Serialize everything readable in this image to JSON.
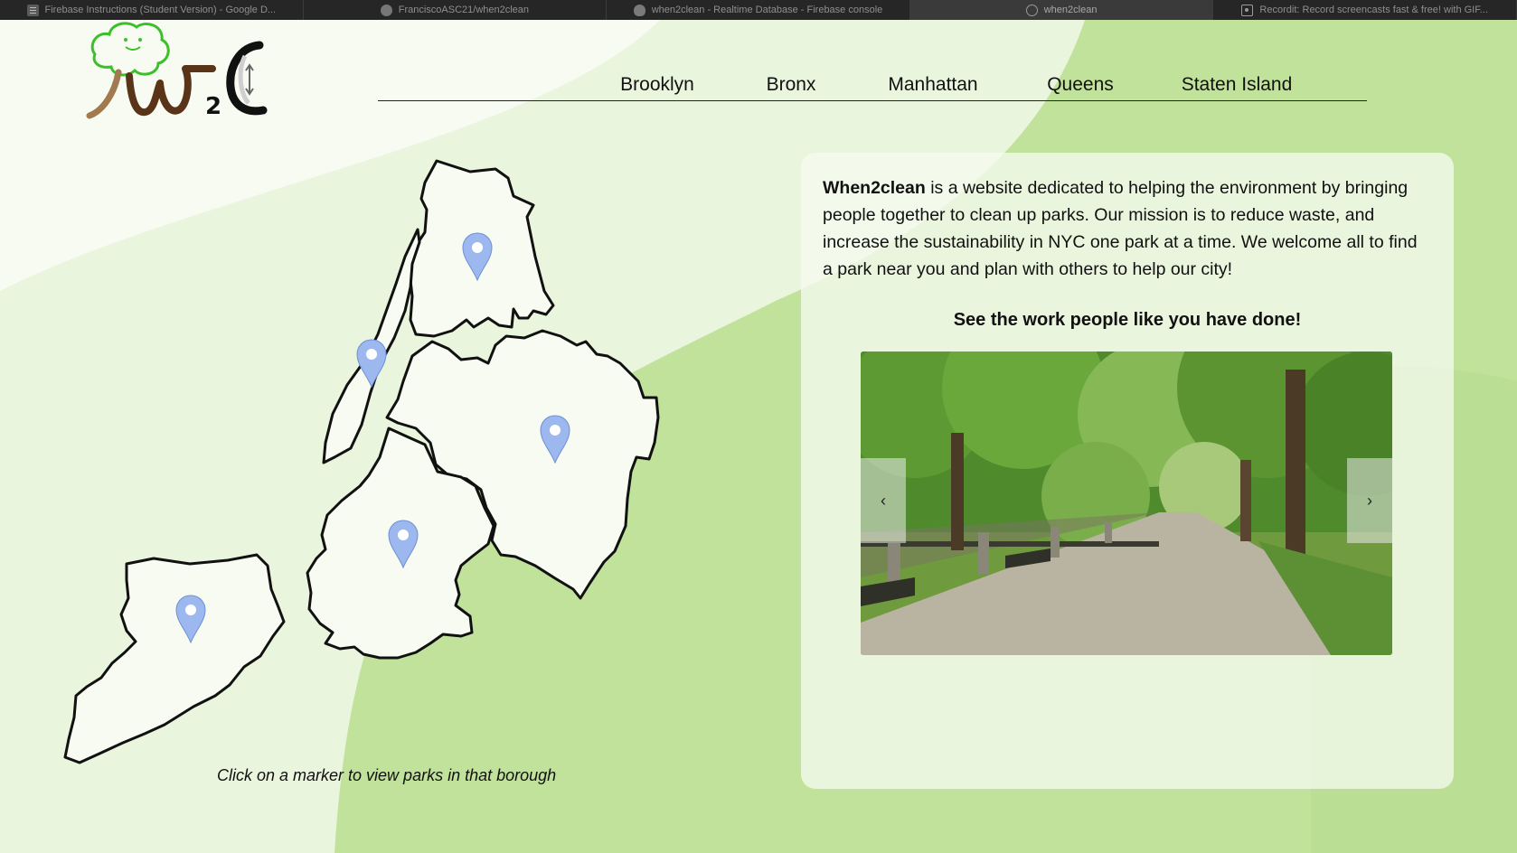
{
  "browser": {
    "tabs": [
      {
        "title": "Firebase Instructions (Student Version) - Google D...",
        "icon": "document-icon",
        "active": false
      },
      {
        "title": "FranciscoASC21/when2clean",
        "icon": "github-icon",
        "active": false
      },
      {
        "title": "when2clean - Realtime Database - Firebase console",
        "icon": "firebase-icon",
        "active": false
      },
      {
        "title": "when2clean",
        "icon": "compass-icon",
        "active": true
      },
      {
        "title": "Recordit: Record screencasts fast & free! with GIF...",
        "icon": "record-icon",
        "active": false
      }
    ]
  },
  "logo": {
    "text": "W2C",
    "icon": "tree-clock-logo"
  },
  "nav": {
    "items": [
      "Brooklyn",
      "Bronx",
      "Manhattan",
      "Queens",
      "Staten Island"
    ]
  },
  "map": {
    "caption": "Click on a marker to view parks in that borough",
    "markers": [
      "Bronx",
      "Manhattan",
      "Queens",
      "Brooklyn",
      "Staten Island"
    ],
    "marker_icon": "map-pin-icon",
    "marker_color": "#9db8ef"
  },
  "about": {
    "brand": "When2clean",
    "description": " is a website dedicated to helping the environment by bringing people together to clean up parks. Our mission is to reduce waste, and increase the sustainability in NYC one park at a time. We welcome all to find a park near you and plan with others to help our city!"
  },
  "gallery": {
    "title": "See the work people like you have done!",
    "prev_label": "‹",
    "next_label": "›",
    "image": "park-path-photo"
  },
  "colors": {
    "light_green": "#eaf5de",
    "mid_green": "#c0e29a",
    "pale": "#f7fbf2",
    "tab_bar": "#262626"
  }
}
